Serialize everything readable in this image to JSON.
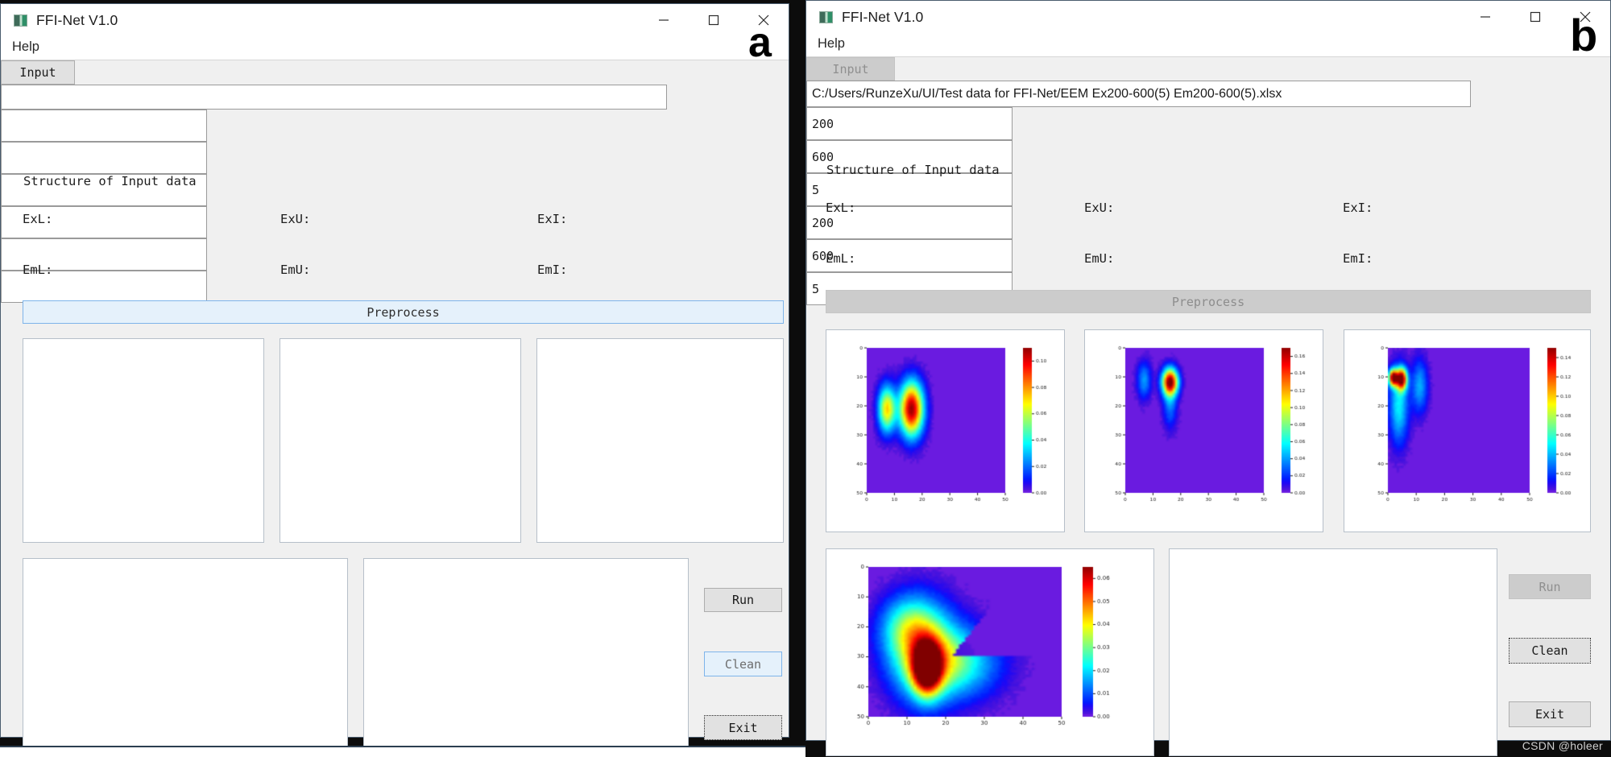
{
  "watermark": "CSDN @holeer",
  "window_a": {
    "letter": "a",
    "title": "FFI-Net V1.0",
    "icon": "app-icon",
    "menu": [
      "Help"
    ],
    "win_buttons": [
      {
        "name": "minimize-button",
        "glyph": "minimize-icon"
      },
      {
        "name": "maximize-button",
        "glyph": "maximize-icon"
      },
      {
        "name": "close-button",
        "glyph": "close-icon"
      }
    ],
    "input_button": "Input",
    "path_value": "",
    "path_placeholder": "",
    "structure_label": "Structure of Input data",
    "fields": [
      {
        "label": "ExL:",
        "value": ""
      },
      {
        "label": "ExU:",
        "value": ""
      },
      {
        "label": "ExI:",
        "value": ""
      },
      {
        "label": "EmL:",
        "value": ""
      },
      {
        "label": "EmU:",
        "value": ""
      },
      {
        "label": "EmI:",
        "value": ""
      }
    ],
    "preprocess": "Preprocess",
    "preprocess_state": "hover",
    "actions": [
      {
        "label": "Run",
        "state": "normal"
      },
      {
        "label": "Clean",
        "state": "hover"
      },
      {
        "label": "Exit",
        "state": "focus"
      }
    ],
    "plots_empty": true
  },
  "window_b": {
    "letter": "b",
    "title": "FFI-Net V1.0",
    "icon": "app-icon",
    "menu": [
      "Help"
    ],
    "win_buttons": [
      {
        "name": "minimize-button",
        "glyph": "minimize-icon"
      },
      {
        "name": "maximize-button",
        "glyph": "maximize-icon"
      },
      {
        "name": "close-button",
        "glyph": "close-icon"
      }
    ],
    "input_button": "Input",
    "path_value": "C:/Users/RunzeXu/UI/Test data for FFI-Net/EEM Ex200-600(5) Em200-600(5).xlsx",
    "structure_label": "Structure of Input data",
    "fields": [
      {
        "label": "ExL:",
        "value": "200"
      },
      {
        "label": "ExU:",
        "value": "600"
      },
      {
        "label": "ExI:",
        "value": "5"
      },
      {
        "label": "EmL:",
        "value": "200"
      },
      {
        "label": "EmU:",
        "value": "600"
      },
      {
        "label": "EmI:",
        "value": "5"
      }
    ],
    "preprocess": "Preprocess",
    "preprocess_state": "disabled",
    "actions": [
      {
        "label": "Run",
        "state": "disabled"
      },
      {
        "label": "Clean",
        "state": "focus"
      },
      {
        "label": "Exit",
        "state": "normal"
      }
    ]
  },
  "chart_data": [
    {
      "id": "component-1",
      "type": "heatmap",
      "title": "",
      "xlabel": "",
      "ylabel": "",
      "xticks": [
        0,
        10,
        20,
        30,
        40,
        50
      ],
      "yticks": [
        0,
        10,
        20,
        30,
        40,
        50
      ],
      "xlim": [
        0,
        50
      ],
      "ylim": [
        50,
        0
      ],
      "colorbar_ticks": [
        "0.00",
        "0.02",
        "0.04",
        "0.06",
        "0.08",
        "0.10"
      ],
      "vmin": 0.0,
      "vmax": 0.11,
      "colormap": "jet",
      "blobs": [
        {
          "cx": 7,
          "cy": 21,
          "sx": 2.2,
          "sy": 5.5,
          "amp": 0.072
        },
        {
          "cx": 16,
          "cy": 21,
          "sx": 3.0,
          "sy": 6.5,
          "amp": 0.11
        }
      ]
    },
    {
      "id": "component-2",
      "type": "heatmap",
      "title": "",
      "xlabel": "",
      "ylabel": "",
      "xticks": [
        0,
        10,
        20,
        30,
        40,
        50
      ],
      "yticks": [
        0,
        10,
        20,
        30,
        40,
        50
      ],
      "xlim": [
        0,
        50
      ],
      "ylim": [
        50,
        0
      ],
      "colorbar_ticks": [
        "0.00",
        "0.02",
        "0.04",
        "0.06",
        "0.08",
        "0.10",
        "0.12",
        "0.14",
        "0.16"
      ],
      "vmin": 0.0,
      "vmax": 0.17,
      "colormap": "jet",
      "blobs": [
        {
          "cx": 6.5,
          "cy": 11,
          "sx": 1.8,
          "sy": 4.5,
          "amp": 0.04
        },
        {
          "cx": 16,
          "cy": 11.5,
          "sx": 2.0,
          "sy": 3.2,
          "amp": 0.17
        },
        {
          "cx": 16,
          "cy": 19,
          "sx": 1.8,
          "sy": 6.0,
          "amp": 0.035
        }
      ]
    },
    {
      "id": "component-3",
      "type": "heatmap",
      "title": "",
      "xlabel": "",
      "ylabel": "",
      "xticks": [
        0,
        10,
        20,
        30,
        40,
        50
      ],
      "yticks": [
        0,
        10,
        20,
        30,
        40,
        50
      ],
      "xlim": [
        0,
        50
      ],
      "ylim": [
        50,
        0
      ],
      "colorbar_ticks": [
        "0.00",
        "0.02",
        "0.04",
        "0.06",
        "0.08",
        "0.10",
        "0.12",
        "0.14"
      ],
      "vmin": 0.0,
      "vmax": 0.15,
      "colormap": "jet",
      "blobs": [
        {
          "cx": 1.5,
          "cy": 10,
          "sx": 1.1,
          "sy": 2.0,
          "amp": 0.15
        },
        {
          "cx": 4.5,
          "cy": 10.5,
          "sx": 1.3,
          "sy": 2.6,
          "amp": 0.15
        },
        {
          "cx": 3.5,
          "cy": 20,
          "sx": 2.4,
          "sy": 9.0,
          "amp": 0.05
        },
        {
          "cx": 11,
          "cy": 13,
          "sx": 2.0,
          "sy": 6.5,
          "amp": 0.038
        }
      ]
    },
    {
      "id": "reconstructed-eem",
      "type": "heatmap",
      "title": "",
      "xlabel": "",
      "ylabel": "",
      "xticks": [
        0,
        10,
        20,
        30,
        40,
        50
      ],
      "yticks": [
        0,
        10,
        20,
        30,
        40,
        50
      ],
      "xlim": [
        0,
        50
      ],
      "ylim": [
        50,
        0
      ],
      "colorbar_ticks": [
        "0.00",
        "0.01",
        "0.02",
        "0.03",
        "0.04",
        "0.05",
        "0.06"
      ],
      "vmin": 0.0,
      "vmax": 0.065,
      "colormap": "jet",
      "blobs": [
        {
          "cx": 15,
          "cy": 34,
          "sx": 2.6,
          "sy": 6.0,
          "amp": 0.065
        },
        {
          "cx": 14,
          "cy": 28,
          "sx": 6.0,
          "sy": 11.0,
          "amp": 0.03
        },
        {
          "cx": 22,
          "cy": 32,
          "sx": 8.0,
          "sy": 8.0,
          "amp": 0.026
        },
        {
          "cx": 10,
          "cy": 20,
          "sx": 5.0,
          "sy": 7.0,
          "amp": 0.02
        }
      ],
      "mask": "upper-right-triangle"
    }
  ]
}
